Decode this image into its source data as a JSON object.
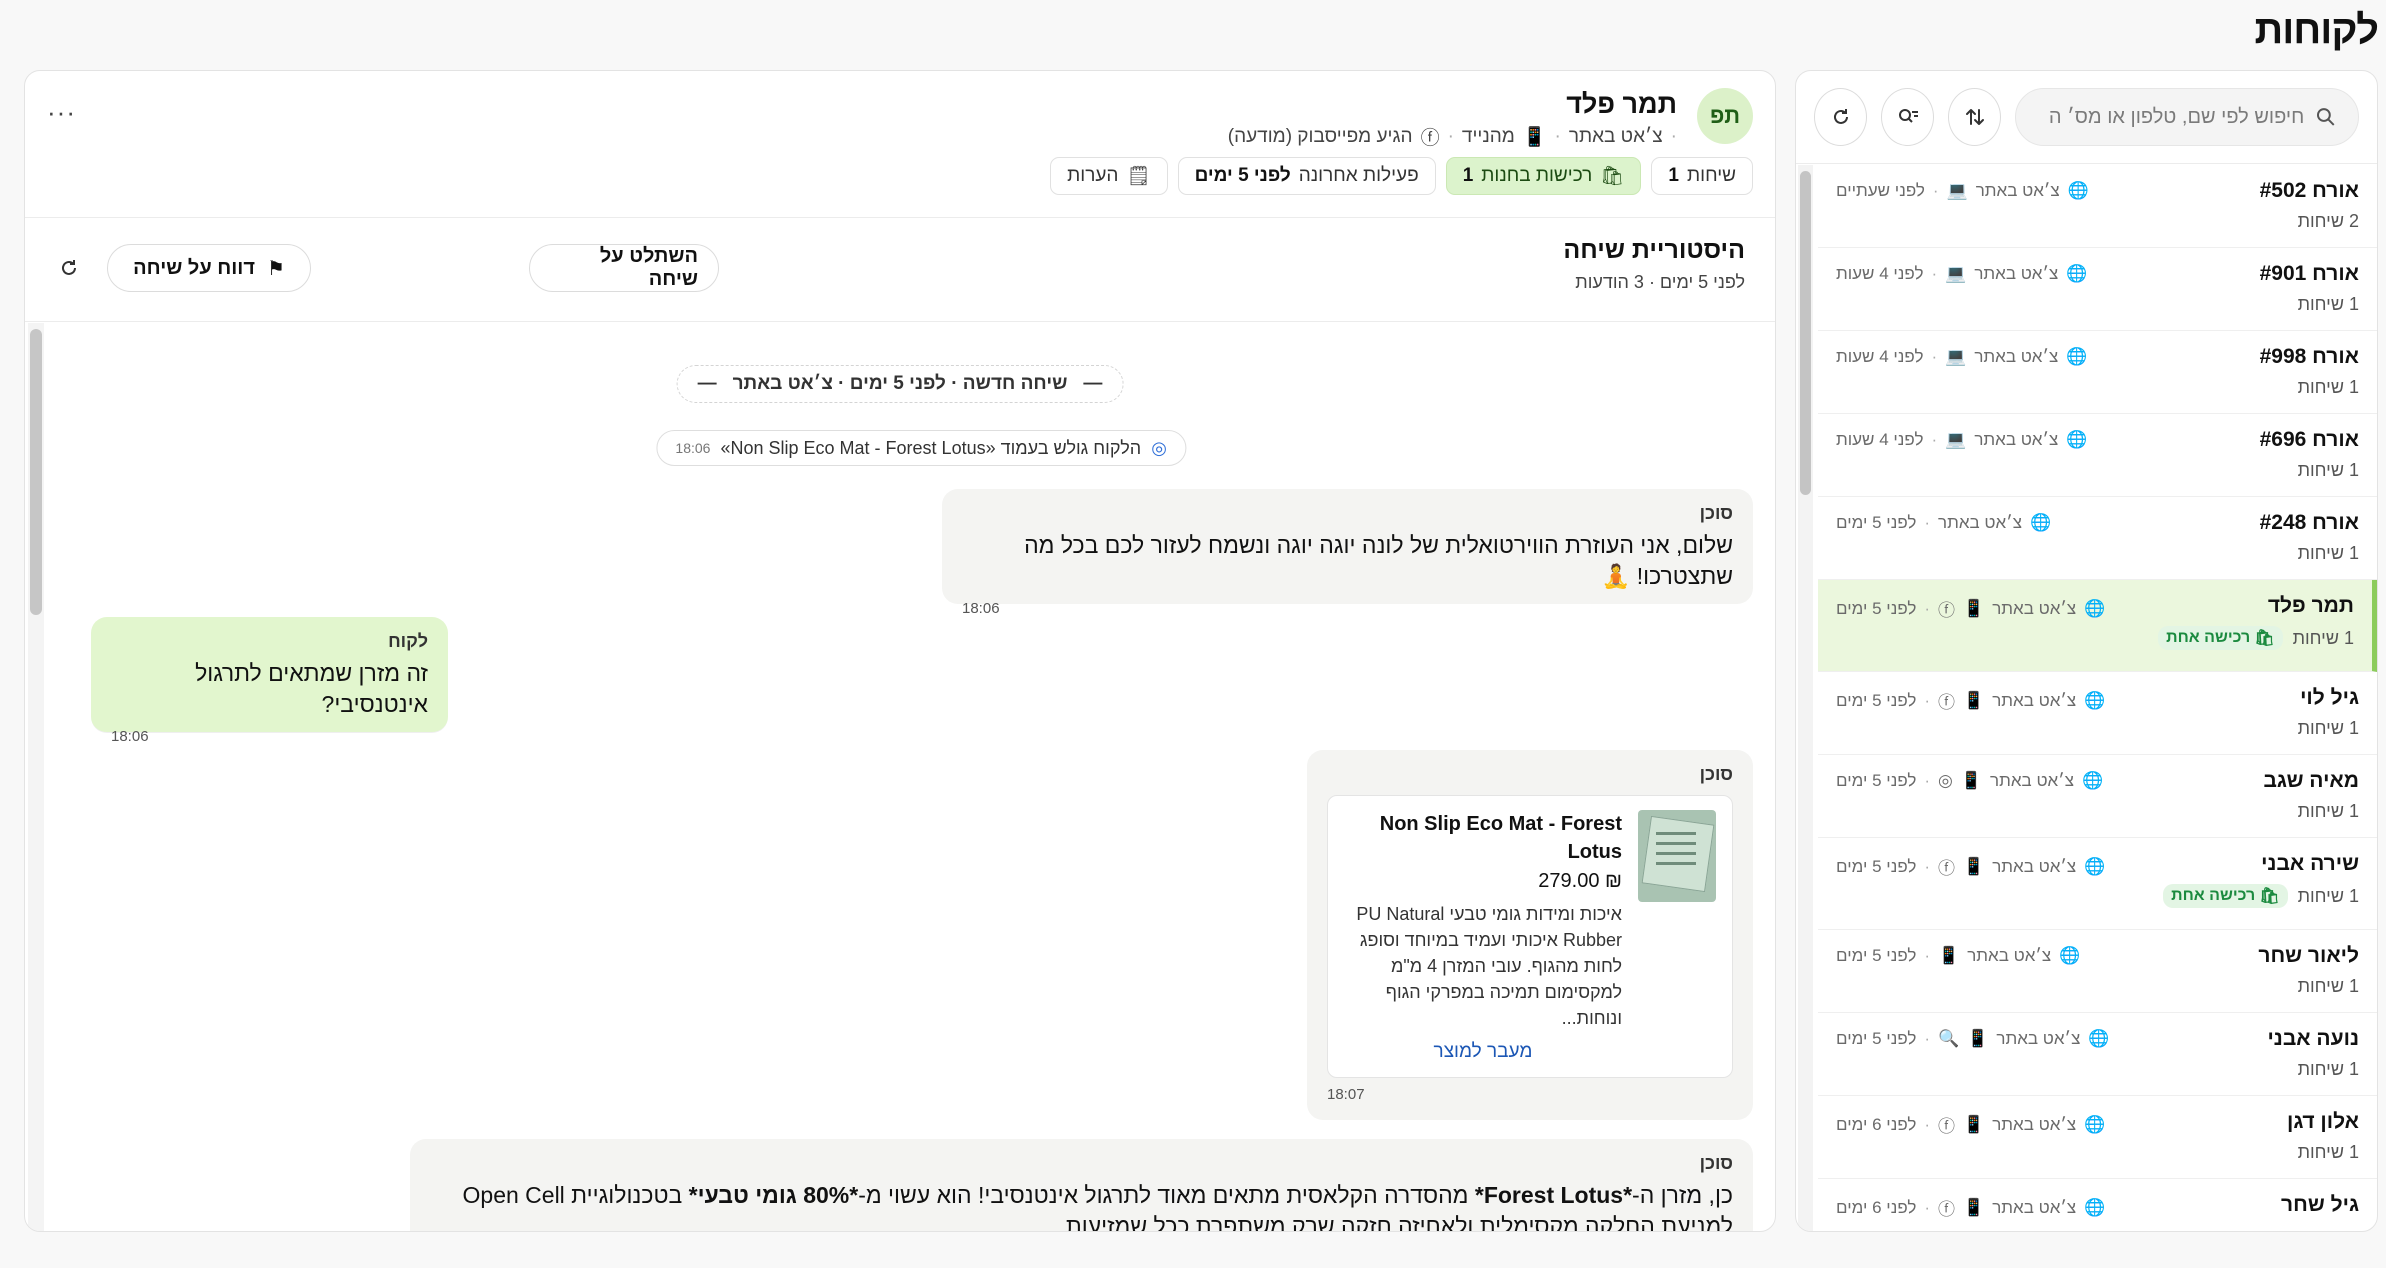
{
  "page": {
    "title": "לקוחות"
  },
  "list": {
    "search_placeholder": "חיפוש לפי שם, טלפון או מס׳ ה",
    "items": [
      {
        "name": "אורח #502",
        "convs": "2 שיחות",
        "channel": "צ׳אט באתר",
        "time": "לפני שעתיים"
      },
      {
        "name": "אורח #901",
        "convs": "1 שיחות",
        "channel": "צ׳אט באתר",
        "time": "לפני 4 שעות"
      },
      {
        "name": "אורח #998",
        "convs": "1 שיחות",
        "channel": "צ׳אט באתר",
        "time": "לפני 4 שעות"
      },
      {
        "name": "אורח #696",
        "convs": "1 שיחות",
        "channel": "צ׳אט באתר",
        "time": "לפני 4 שעות"
      },
      {
        "name": "אורח #248",
        "convs": "1 שיחות",
        "channel": "צ׳אט באתר",
        "time": "לפני 5 ימים"
      },
      {
        "name": "תמר פלד",
        "convs": "1 שיחות",
        "channel": "צ׳אט באתר",
        "time": "לפני 5 ימים",
        "tag": "רכישה אחת"
      },
      {
        "name": "גיל לוי",
        "convs": "1 שיחות",
        "channel": "צ׳אט באתר",
        "time": "לפני 5 ימים"
      },
      {
        "name": "מאיה שגב",
        "convs": "1 שיחות",
        "channel": "צ׳אט באתר",
        "time": "לפני 5 ימים"
      },
      {
        "name": "שירה אבני",
        "convs": "1 שיחות",
        "channel": "צ׳אט באתר",
        "time": "לפני 5 ימים",
        "tag": "רכישה אחת"
      },
      {
        "name": "ליאור שחר",
        "convs": "1 שיחות",
        "channel": "צ׳אט באתר",
        "time": "לפני 5 ימים"
      },
      {
        "name": "נועה אבני",
        "convs": "1 שיחות",
        "channel": "צ׳אט באתר",
        "time": "לפני 5 ימים"
      },
      {
        "name": "אלון דגן",
        "convs": "1 שיחות",
        "channel": "צ׳אט באתר",
        "time": "לפני 6 ימים"
      },
      {
        "name": "גיל שחר",
        "convs": "",
        "channel": "צ׳אט באתר",
        "time": "לפני 6 ימים"
      }
    ]
  },
  "header": {
    "avatar": "תפ",
    "name": "תמר פלד",
    "info": {
      "channel": "צ׳אט באתר",
      "device": "מהנייד",
      "source": "הגיע מפייסבוק (מודעה)"
    },
    "stats": {
      "convs_label": "שיחות",
      "convs_value": "1",
      "buys_label": "רכישות בחנות",
      "buys_value": "1",
      "activity_label": "פעילות אחרונה",
      "activity_value": "לפני 5 ימים",
      "notes_label": "הערות"
    },
    "more": "···"
  },
  "history": {
    "title": "היסטוריית שיחה",
    "sub": "לפני 5 ימים · 3 הודעות",
    "takeover": "השתלט על שיחה",
    "report": "דווח על שיחה"
  },
  "chat": {
    "separator": "שיחה חדשה · לפני 5 ימים · צ׳אט באתר",
    "browse_text": "הלקוח גולש בעמוד «Non Slip Eco Mat - Forest Lotus»",
    "browse_time": "18:06",
    "messages": [
      {
        "sender": "סוכן",
        "text": "שלום, אני העוזרת הווירטואלית של לונה יוגה יוגה ונשמח לעזור לכם בכל מה שתצטרכו! 🧘",
        "time": "18:06"
      },
      {
        "sender": "לקוח",
        "text": "זה מזרן שמתאים לתרגול אינטנסיבי?",
        "time": "18:06"
      },
      {
        "sender": "סוכן",
        "time": "18:07",
        "product": {
          "name": "Non Slip Eco Mat - Forest Lotus",
          "price": "₪ 279.00",
          "desc": "איכות ומידות גומי טבעי PU Natural Rubber איכותי ועמיד במיוחד וסופג לחות מהגוף. עובי המזרן 4 מ\"מ למקסימום תמיכה במפרקי הגוף ונוחות...",
          "link": "מעבר למוצר"
        }
      },
      {
        "sender": "סוכן",
        "text_pre": "כן, מזרן ה-",
        "text_b1": "*Forest Lotus*",
        "text_mid": " מהסדרה הקלאסית מתאים מאוד לתרגול אינטנסיבי! הוא עשוי מ-",
        "text_b2": "*80% גומי טבעי*",
        "text_post": " בטכנולוגיית Open Cell למניעת החלקה מקסימלית ולאחיזה חזקה שרק משתפרת ככל שמזיעות."
      }
    ]
  },
  "colors": {
    "accent": "#8ccc5c",
    "customer_bubble": "#e2f6ce",
    "agent_bubble": "#f4f4f2",
    "link": "#1c57b5"
  }
}
